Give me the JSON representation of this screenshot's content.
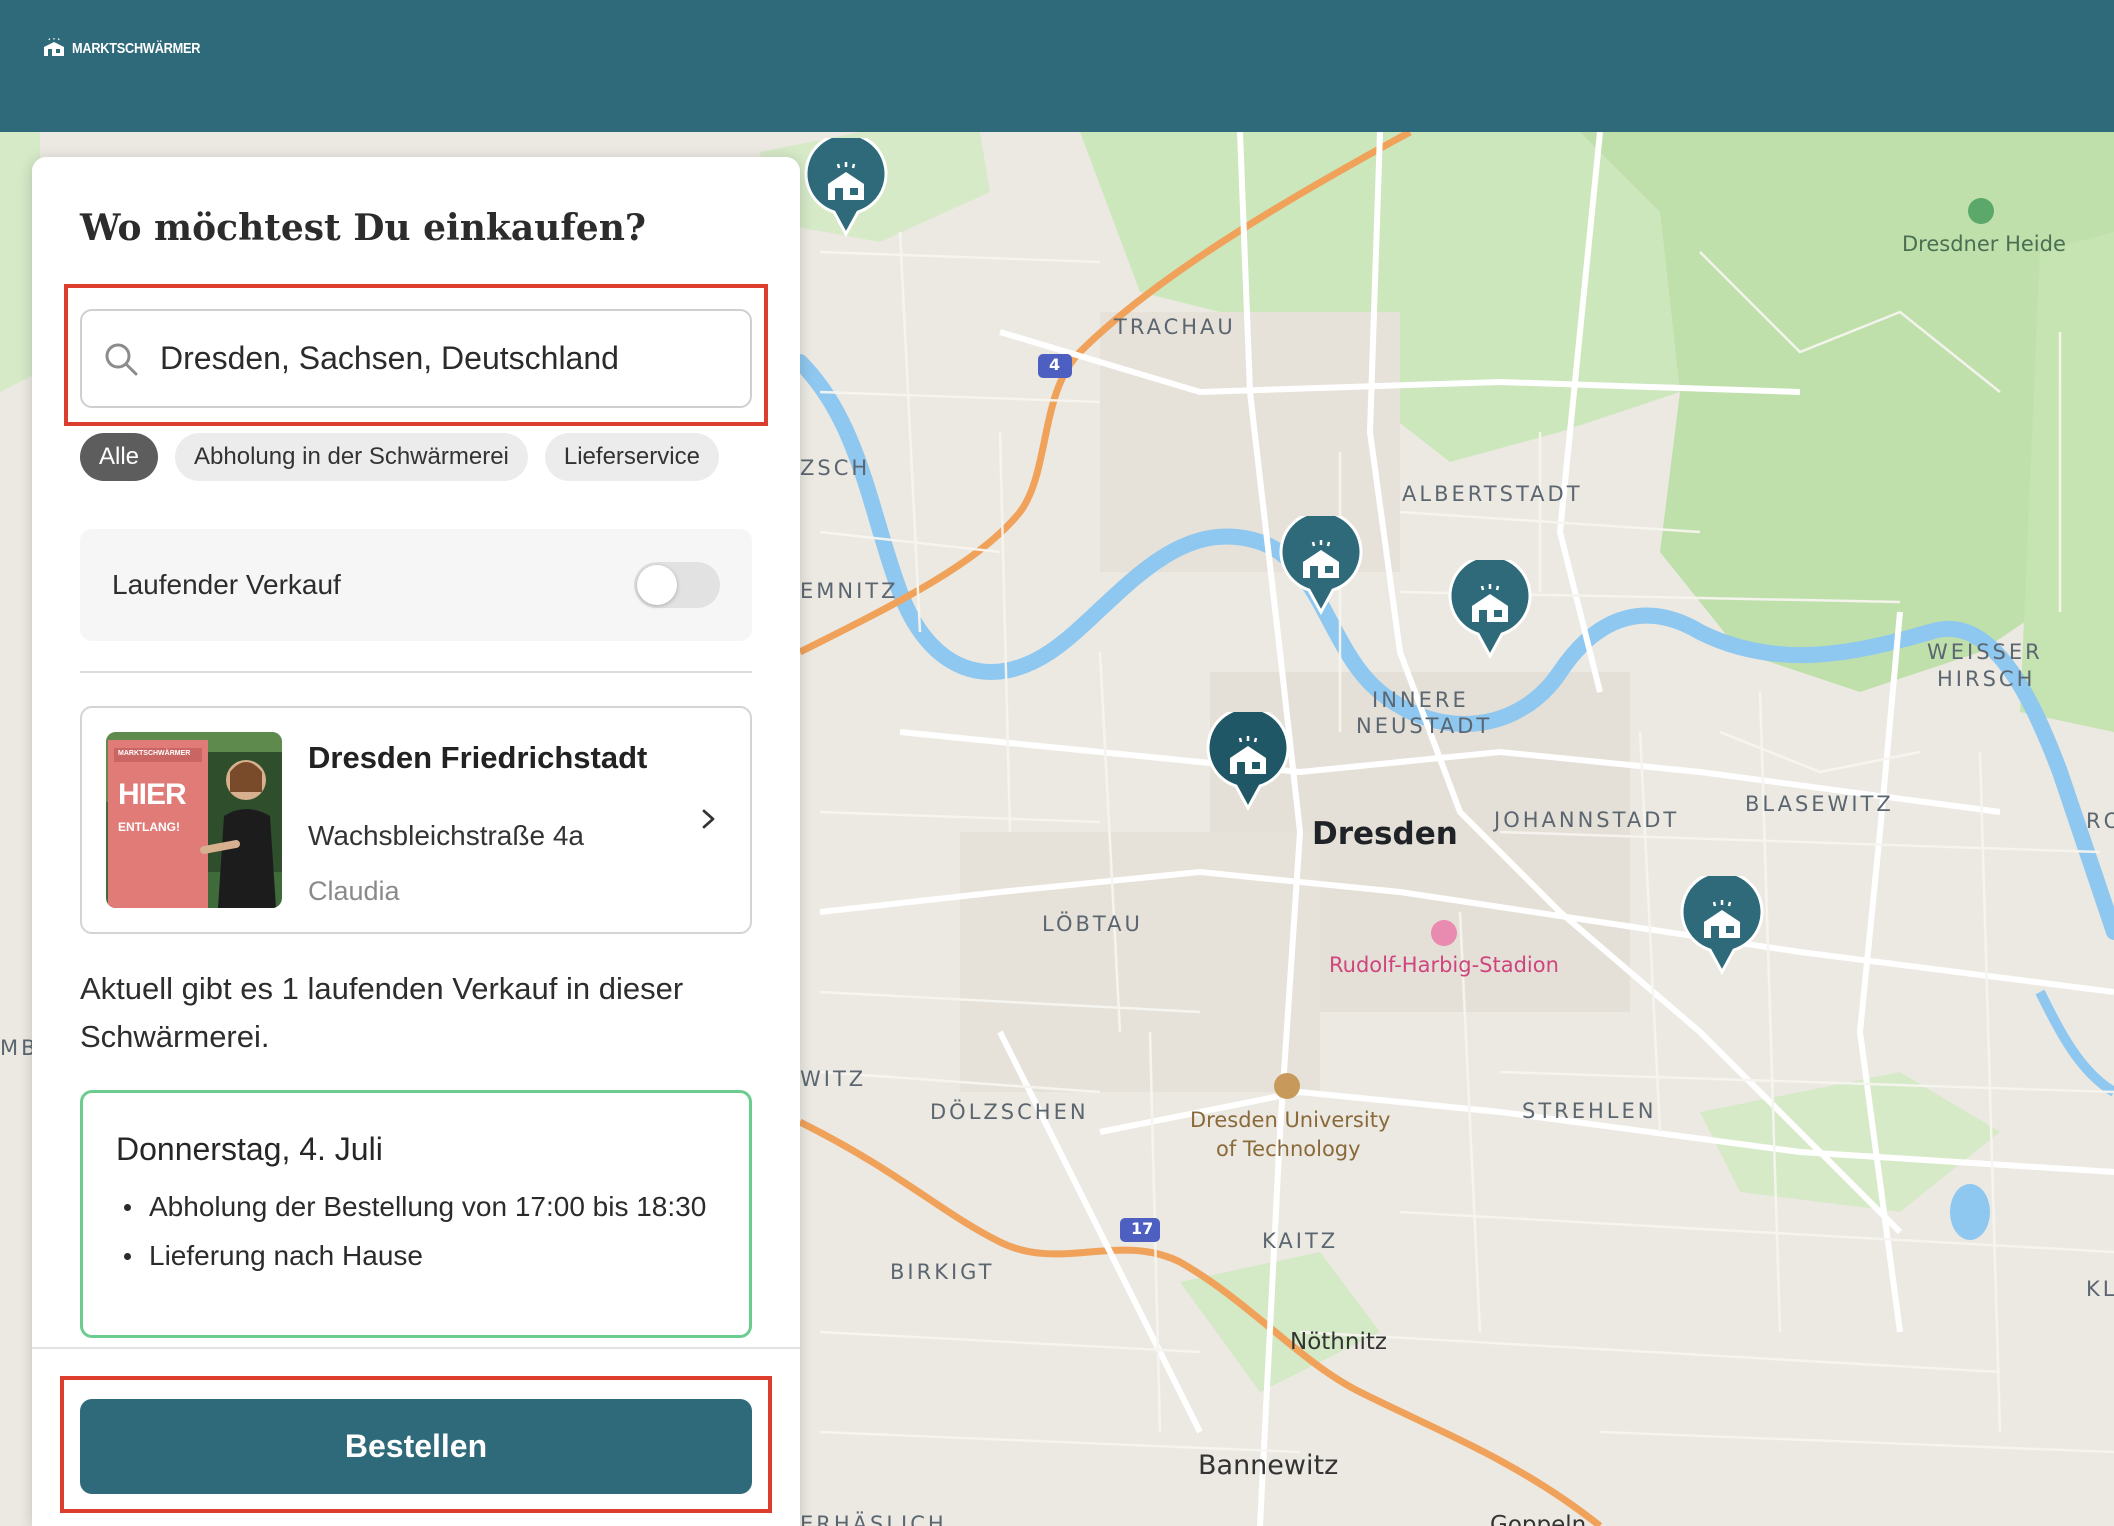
{
  "header": {
    "brand": "MARKTSCHWÄRMER",
    "bg_color": "#2f6a7a"
  },
  "panel": {
    "title": "Wo möchtest Du einkaufen?",
    "search": {
      "value": "Dresden, Sachsen, Deutschland",
      "icon": "search-icon"
    },
    "filters": [
      {
        "label": "Alle",
        "active": true
      },
      {
        "label": "Abholung in der Schwärmerei",
        "active": false
      },
      {
        "label": "Lieferservice",
        "active": false
      }
    ],
    "toggle": {
      "label": "Laufender Verkauf",
      "on": false
    },
    "shop": {
      "name": "Dresden Friedrichstadt",
      "address": "Wachsbleichstraße 4a",
      "host": "Claudia",
      "photo_sign_title": "HIER",
      "photo_sign_sub": "ENTLANG!",
      "photo_sign_brand": "MARKTSCHWÄRMER"
    },
    "info": "Aktuell gibt es 1 laufenden Verkauf in dieser Schwärmerei.",
    "sale": {
      "date": "Donnerstag, 4. Juli",
      "items": [
        "Abholung der Bestellung von 17:00 bis 18:30",
        "Lieferung nach Hause"
      ]
    },
    "order_button": "Bestellen",
    "accent_color": "#2f6a7a",
    "highlight_color": "#dd3d2c"
  },
  "map": {
    "labels": {
      "trachau": "TRACHAU",
      "albertstadt": "ALBERTSTADT",
      "innere1": "INNERE",
      "innere2": "NEUSTADT",
      "dresden": "Dresden",
      "johannstadt": "JOHANNSTADT",
      "blasewitz": "BLASEWITZ",
      "weisser1": "WEISSER",
      "weisser2": "HIRSCH",
      "heide": "Dresdner Heide",
      "loebtau": "LÖBTAU",
      "stadion": "Rudolf-Harbig-Stadion",
      "uni1": "Dresden University",
      "uni2": "of Technology",
      "doelzschen": "DÖLZSCHEN",
      "strehlen": "STREHLEN",
      "birkigt": "BIRKIGT",
      "kaitz": "KAITZ",
      "noethnitz": "Nöthnitz",
      "bannewitz": "Bannewitz",
      "gompitz": "ZSCH",
      "kemnitz": "EMNITZ",
      "witz": "WITZ",
      "ro": "RO",
      "kl": "KL",
      "mb": "MB",
      "gostritz": "Goppeln",
      "ueb": "ERHÄSLICH",
      "road4": "4",
      "road17": "17"
    },
    "markers": [
      "market-pin",
      "market-pin",
      "market-pin",
      "market-pin",
      "market-pin"
    ],
    "water_color": "#8ec7ef",
    "park_color": "#c8e5b6",
    "motorway_color": "#f0a25a"
  }
}
